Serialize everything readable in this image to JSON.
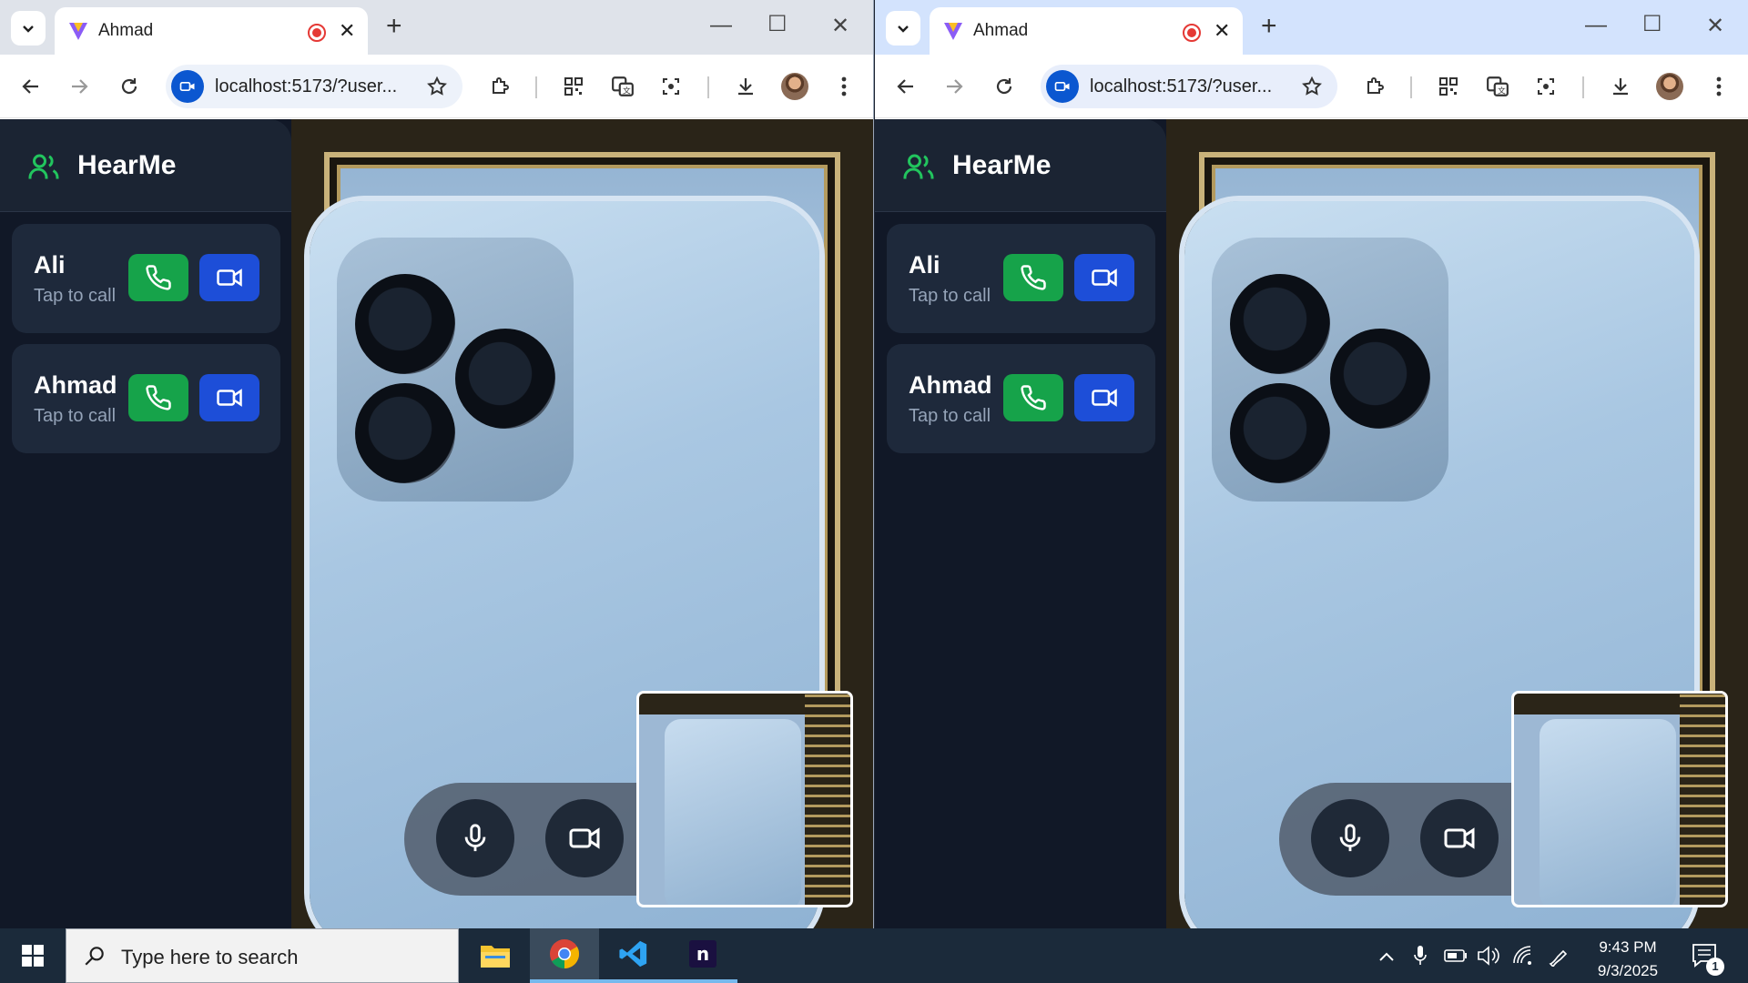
{
  "windows": [
    {
      "tab_title": "Ahmad",
      "url": "localhost:5173/?user...",
      "app": {
        "brand": "HearMe",
        "contacts": [
          {
            "name": "Ali",
            "subtitle": "Tap to call"
          },
          {
            "name": "Ahmad",
            "subtitle": "Tap to call"
          }
        ]
      }
    },
    {
      "tab_title": "Ahmad",
      "url": "localhost:5173/?user...",
      "app": {
        "brand": "HearMe",
        "contacts": [
          {
            "name": "Ali",
            "subtitle": "Tap to call"
          },
          {
            "name": "Ahmad",
            "subtitle": "Tap to call"
          }
        ]
      }
    }
  ],
  "colors": {
    "voice_button": "#16a34a",
    "video_button": "#1d4ed8",
    "end_call": "#dc2626",
    "brand_icon": "#22c55e",
    "app_background": "#111827"
  },
  "icons": [
    "phone-icon",
    "video-camera-icon",
    "microphone-icon",
    "phone-off-icon",
    "users-icon"
  ],
  "taskbar": {
    "search_placeholder": "Type here to search",
    "time": "9:43 PM",
    "date": "9/3/2025",
    "notification_count": "1",
    "pinned_apps": [
      "File Explorer",
      "Google Chrome",
      "Visual Studio Code",
      "Notion"
    ]
  }
}
